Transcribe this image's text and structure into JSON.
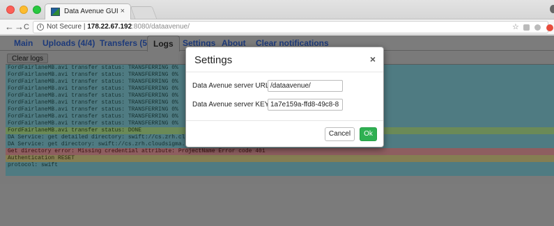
{
  "browser": {
    "tab_title": "Data Avenue GUI",
    "tab_close": "×",
    "back": "←",
    "forward": "→",
    "reload": "C",
    "security_label": "Not Secure",
    "url_separator": "|",
    "url_host": "178.22.67.192",
    "url_path": ":8080/dataavenue/",
    "star": "☆"
  },
  "nav": {
    "main": "Main",
    "uploads": "Uploads (4/4)",
    "transfers": "Transfers (5)",
    "logs": "Logs",
    "settings": "Settings",
    "about": "About",
    "clear_notifications": "Clear notifications"
  },
  "logs": {
    "clear_label": "Clear logs",
    "lines": [
      {
        "text": "FordFairlaneMB.avi transfer status: TRANSFERRING 0%",
        "level": "info"
      },
      {
        "text": "FordFairlaneMB.avi transfer status: TRANSFERRING 0%",
        "level": "info"
      },
      {
        "text": "FordFairlaneMB.avi transfer status: TRANSFERRING 0%",
        "level": "info"
      },
      {
        "text": "FordFairlaneMB.avi transfer status: TRANSFERRING 0%",
        "level": "info"
      },
      {
        "text": "FordFairlaneMB.avi transfer status: TRANSFERRING 0%",
        "level": "info"
      },
      {
        "text": "FordFairlaneMB.avi transfer status: TRANSFERRING 0%",
        "level": "info"
      },
      {
        "text": "FordFairlaneMB.avi transfer status: TRANSFERRING 0%",
        "level": "info"
      },
      {
        "text": "FordFairlaneMB.avi transfer status: TRANSFERRING 0%",
        "level": "info"
      },
      {
        "text": "FordFairlaneMB.avi transfer status: TRANSFERRING 0%",
        "level": "info"
      },
      {
        "text": "FordFairlaneMB.avi transfer status: DONE",
        "level": "success"
      },
      {
        "text": "DA Service: get detailed directory: swift://cs.zrh.clouds",
        "level": "info"
      },
      {
        "text": "DA Service: get directory: swift://cs.zrh.cloudsigma.com:",
        "level": "info"
      },
      {
        "text": "Get directory error: Missing credential attribute: ProjectName Error code 401",
        "level": "error"
      },
      {
        "text": "Authentication RESET",
        "level": "warning"
      },
      {
        "text": "protocol: swift",
        "level": "info"
      }
    ]
  },
  "modal": {
    "title": "Settings",
    "close": "×",
    "url_label": "Data Avenue server URL:",
    "url_value": "/dataavenue/",
    "key_label": "Data Avenue server KEY:",
    "key_value": "1a7e159a-ffd8-49c8-8",
    "cancel": "Cancel",
    "ok": "Ok"
  },
  "colors": {
    "ok_button": "#2fb052",
    "info_row": "#4f7b82",
    "error_row": "#8e5e60",
    "warning_row": "#857e52",
    "success_row": "#6b8a57"
  }
}
